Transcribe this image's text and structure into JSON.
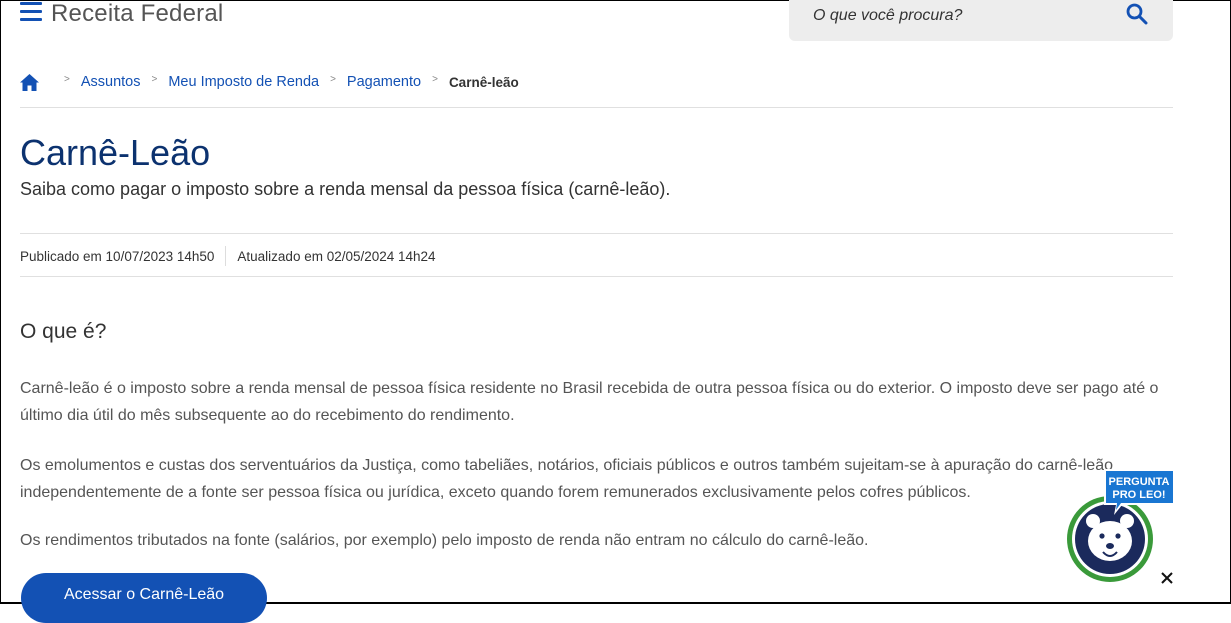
{
  "header": {
    "site_title": "Receita Federal",
    "search_placeholder": "O que você procura?"
  },
  "breadcrumb": {
    "items": [
      "Assuntos",
      "Meu Imposto de Renda",
      "Pagamento"
    ],
    "current": "Carnê-leão",
    "separator": ">"
  },
  "page": {
    "title": "Carnê-Leão",
    "subtitle": "Saiba como pagar o imposto sobre a renda mensal da pessoa física (carnê-leão).",
    "published": "Publicado em 10/07/2023 14h50",
    "updated": "Atualizado em 02/05/2024 14h24",
    "section_heading": "O que é?",
    "paragraphs": [
      "Carnê-leão é o imposto sobre a renda mensal de pessoa física residente no Brasil recebida de outra pessoa física ou do exterior. O imposto deve ser pago até o último dia útil do mês subsequente ao do recebimento do rendimento.",
      "Os emolumentos e custas dos serventuários da Justiça, como tabeliães, notários, oficiais públicos e outros também sujeitam-se à apuração do carnê-leão independentemente de a fonte ser pessoa física ou jurídica, exceto quando forem remunerados exclusivamente pelos cofres públicos.",
      "Os rendimentos tributados na fonte (salários, por exemplo) pelo imposto de renda não entram no cálculo do carnê-leão."
    ],
    "cta_label": "Acessar o Carnê-Leão"
  },
  "leo_widget": {
    "label_line1": "PERGUNTA",
    "label_line2": "PRO LEO!"
  },
  "colors": {
    "primary": "#1351b4",
    "title": "#0c326f",
    "leo_green": "#3a9a3a",
    "leo_navy": "#1b2a5c"
  },
  "icons": [
    "menu-icon",
    "search-icon",
    "home-icon",
    "close-icon"
  ]
}
